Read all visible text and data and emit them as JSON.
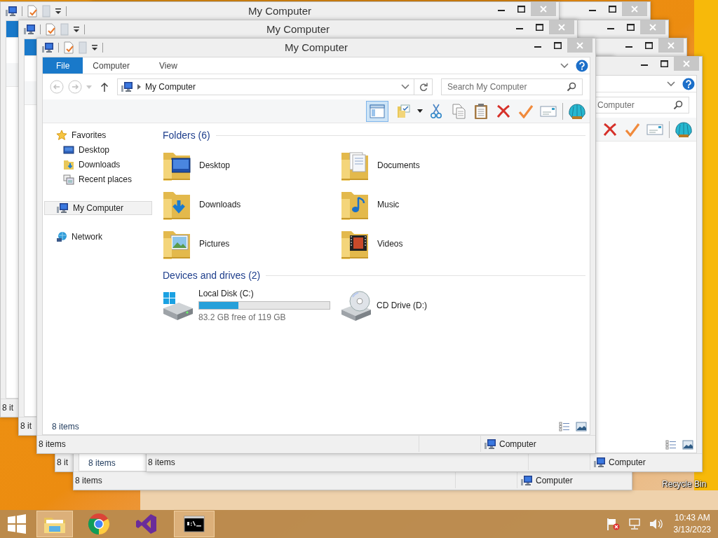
{
  "desktop_icons": [
    {
      "label": "Recycle Bin"
    }
  ],
  "back_windows": [
    {
      "title": "My Computer",
      "status_text": "8 it"
    },
    {
      "title": "My Computer",
      "status_text": "8 it"
    },
    {
      "status_text": "8 it"
    },
    {
      "details": "8 items",
      "status_text": "8 items",
      "location": "Computer"
    },
    {
      "search": {
        "placeholder": "Computer"
      },
      "status_text": "8 items",
      "location": "Computer"
    }
  ],
  "window": {
    "title": "My Computer",
    "ribbon_tabs": [
      {
        "label": "File",
        "selected": true
      },
      {
        "label": "Computer",
        "selected": false
      },
      {
        "label": "View",
        "selected": false
      }
    ],
    "address": "My Computer",
    "search": {
      "placeholder": "Search My Computer"
    },
    "toolbar": [
      {
        "kind": "pane",
        "on": true
      },
      {
        "kind": "folder-options"
      },
      {
        "kind": "cut"
      },
      {
        "kind": "copy"
      },
      {
        "kind": "paste"
      },
      {
        "kind": "delete"
      },
      {
        "kind": "check"
      },
      {
        "kind": "card"
      },
      {
        "kind": "shell"
      }
    ],
    "nav": [
      {
        "label": "Favorites",
        "kind": "favorites",
        "selected": false,
        "children": [
          {
            "label": "Desktop",
            "kind": "desktop",
            "selected": false
          },
          {
            "label": "Downloads",
            "kind": "downloads",
            "selected": false
          },
          {
            "label": "Recent places",
            "kind": "recent",
            "selected": false
          }
        ]
      },
      {
        "label": "My Computer",
        "kind": "computer",
        "selected": true
      },
      {
        "label": "Network",
        "kind": "network",
        "selected": false
      }
    ],
    "groups": [
      {
        "title": "Folders (6)",
        "items": [
          {
            "label": "Desktop",
            "kind": "desktop"
          },
          {
            "label": "Documents",
            "kind": "documents"
          },
          {
            "label": "Downloads",
            "kind": "downloads"
          },
          {
            "label": "Music",
            "kind": "music"
          },
          {
            "label": "Pictures",
            "kind": "pictures"
          },
          {
            "label": "Videos",
            "kind": "videos"
          }
        ]
      },
      {
        "title": "Devices and drives (2)",
        "items": [
          {
            "label": "Local Disk (C:)",
            "kind": "hdd",
            "level": 0.3,
            "free_text": "83.2 GB free of 119 GB"
          },
          {
            "label": "CD Drive (D:)",
            "kind": "cd"
          }
        ]
      }
    ],
    "details": "8 items",
    "status_bar": {
      "items": "8 items",
      "location": "Computer"
    }
  },
  "taskbar": {
    "apps": [
      {
        "kind": "explorer",
        "running": true
      },
      {
        "kind": "chrome",
        "running": false
      },
      {
        "kind": "visual-studio",
        "running": false
      },
      {
        "kind": "terminal",
        "running": true
      }
    ],
    "clock": {
      "time": "10:43 AM",
      "date": "3/13/2023"
    }
  }
}
